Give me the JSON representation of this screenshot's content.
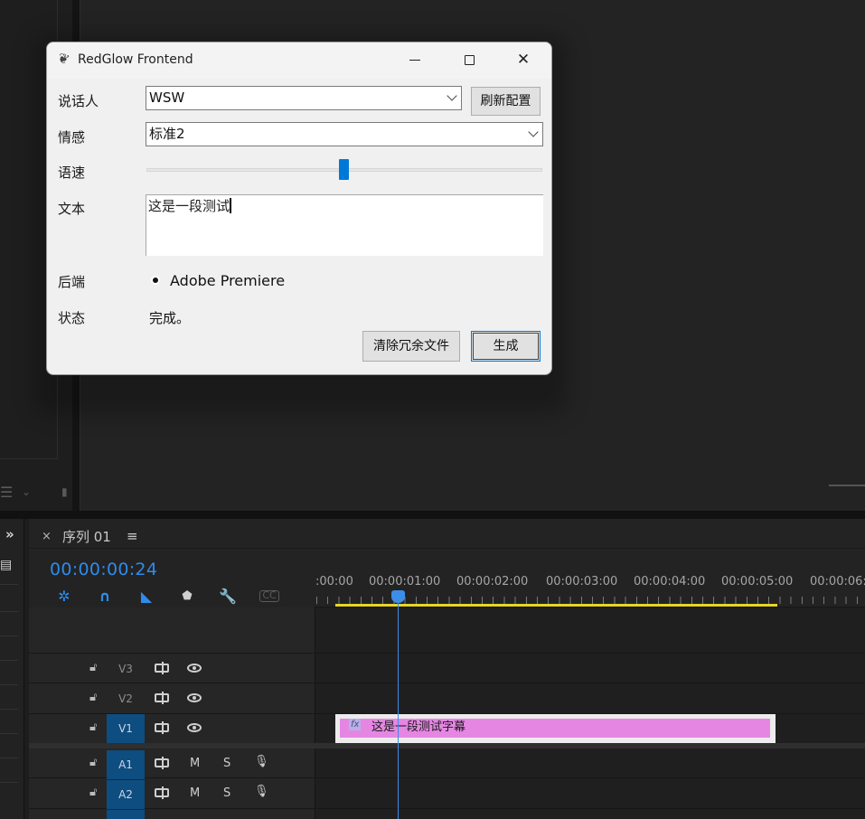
{
  "dialog": {
    "title": "RedGlow Frontend",
    "fields": {
      "speaker_label": "说话人",
      "speaker_value": "WSW",
      "refresh_button": "刷新配置",
      "emotion_label": "情感",
      "emotion_value": "标准2",
      "speed_label": "语速",
      "speed_level": 0.5,
      "text_label": "文本",
      "text_value": "这是一段测试",
      "backend_label": "后端",
      "backend_option": "Adobe Premiere",
      "status_label": "状态",
      "status_value": "完成。"
    },
    "buttons": {
      "clean": "清除冗余文件",
      "generate": "生成"
    }
  },
  "timeline": {
    "close_glyph": "×",
    "sequence_title": "序列 01",
    "menu_glyph": "≡",
    "timecode": "00:00:00:24",
    "ruler_labels": [
      ":00:00",
      "00:00:01:00",
      "00:00:02:00",
      "00:00:03:00",
      "00:00:04:00",
      "00:00:05:00",
      "00:00:06:"
    ],
    "tracks": {
      "v3": "V3",
      "v2": "V2",
      "v1": "V1",
      "a1": "A1",
      "a2": "A2"
    },
    "mute_label": "M",
    "solo_label": "S",
    "clip": {
      "fx": "fx",
      "label": "这是一段测试字幕"
    }
  },
  "colors": {
    "accent": "#2d8ceb",
    "clip": "#e586e3",
    "work_area": "#e6d52c",
    "slider": "#0078d7"
  }
}
